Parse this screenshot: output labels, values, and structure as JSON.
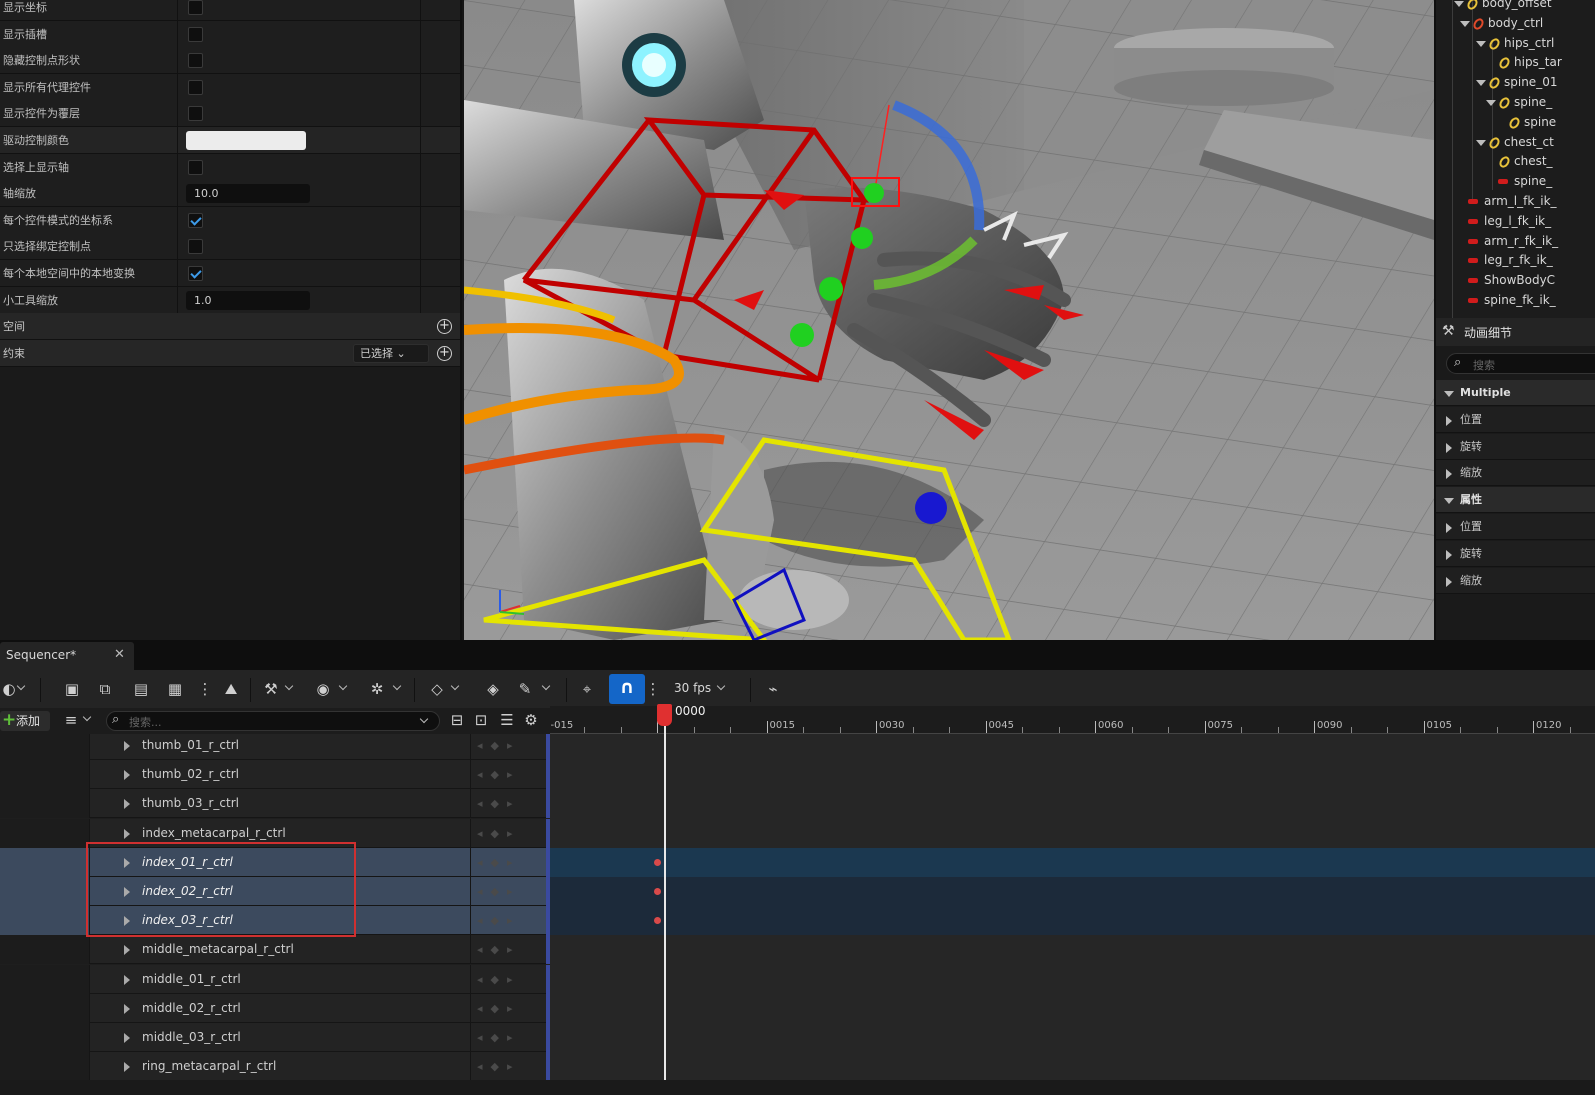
{
  "details": {
    "rows": [
      {
        "label": "显示坐标",
        "type": "checkbox",
        "checked": false
      },
      {
        "label": "显示插槽",
        "type": "checkbox",
        "checked": false
      },
      {
        "label": "隐藏控制点形状",
        "type": "checkbox",
        "checked": false
      },
      {
        "label": "显示所有代理控件",
        "type": "checkbox",
        "checked": false
      },
      {
        "label": "显示控件为覆层",
        "type": "checkbox",
        "checked": false
      },
      {
        "label": "驱动控制颜色",
        "type": "color",
        "value": "#ececec"
      },
      {
        "label": "选择上显示轴",
        "type": "checkbox",
        "checked": false
      },
      {
        "label": "轴缩放",
        "type": "number",
        "value": "10.0"
      },
      {
        "label": "每个控件模式的坐标系",
        "type": "checkbox",
        "checked": true
      },
      {
        "label": "只选择绑定控制点",
        "type": "checkbox",
        "checked": false
      },
      {
        "label": "每个本地空间中的本地变换",
        "type": "checkbox",
        "checked": true
      },
      {
        "label": "小工具缩放",
        "type": "number",
        "value": "1.0"
      }
    ],
    "space_label": "空间",
    "constraint_label": "约束",
    "constraint_dropdown": "已选择"
  },
  "outliner": {
    "items": [
      {
        "label": "body_offset",
        "icon": "ring-yellow"
      },
      {
        "label": "body_ctrl",
        "icon": "ring-red"
      },
      {
        "label": "hips_ctrl",
        "icon": "ring-yellow"
      },
      {
        "label": "hips_tar",
        "icon": "ring-yellow"
      },
      {
        "label": "spine_01",
        "icon": "ring-yellow"
      },
      {
        "label": "spine_",
        "icon": "ring-yellow"
      },
      {
        "label": "spine",
        "icon": "ring-yellow"
      },
      {
        "label": "chest_ct",
        "icon": "ring-yellow"
      },
      {
        "label": "chest_",
        "icon": "ring-yellow"
      },
      {
        "label": "spine_",
        "icon": "bar-red"
      },
      {
        "label": "arm_l_fk_ik_",
        "icon": "bar-red"
      },
      {
        "label": "leg_l_fk_ik_",
        "icon": "bar-red"
      },
      {
        "label": "arm_r_fk_ik_",
        "icon": "bar-red"
      },
      {
        "label": "leg_r_fk_ik_",
        "icon": "bar-red"
      },
      {
        "label": "ShowBodyC",
        "icon": "bar-red"
      },
      {
        "label": "spine_fk_ik_",
        "icon": "bar-red"
      }
    ]
  },
  "anim_details": {
    "title": "动画细节",
    "search_placeholder": "搜索",
    "rows": [
      {
        "label": "Multiple",
        "kind": "category"
      },
      {
        "label": "位置",
        "kind": "item"
      },
      {
        "label": "旋转",
        "kind": "item"
      },
      {
        "label": "缩放",
        "kind": "item"
      },
      {
        "label": "属性",
        "kind": "category"
      },
      {
        "label": "位置",
        "kind": "item"
      },
      {
        "label": "旋转",
        "kind": "item"
      },
      {
        "label": "缩放",
        "kind": "item"
      }
    ]
  },
  "sequencer": {
    "tab_title": "Sequencer*",
    "fps": "30 fps",
    "add_label": "添加",
    "search_placeholder": "搜索...",
    "current_frame": "0000",
    "ruler_labels": [
      "-015",
      "0015",
      "0030",
      "0045",
      "0060",
      "0075",
      "0090",
      "0105",
      "0120"
    ],
    "tracks": [
      {
        "name": "thumb_01_r_ctrl",
        "selected": false
      },
      {
        "name": "thumb_02_r_ctrl",
        "selected": false
      },
      {
        "name": "thumb_03_r_ctrl",
        "selected": false
      },
      {
        "name": "index_metacarpal_r_ctrl",
        "selected": false
      },
      {
        "name": "index_01_r_ctrl",
        "selected": true
      },
      {
        "name": "index_02_r_ctrl",
        "selected": true
      },
      {
        "name": "index_03_r_ctrl",
        "selected": true
      },
      {
        "name": "middle_metacarpal_r_ctrl",
        "selected": false
      },
      {
        "name": "middle_01_r_ctrl",
        "selected": false
      },
      {
        "name": "middle_02_r_ctrl",
        "selected": false
      },
      {
        "name": "middle_03_r_ctrl",
        "selected": false
      },
      {
        "name": "ring_metacarpal_r_ctrl",
        "selected": false
      }
    ]
  },
  "colors": {
    "accent": "#1466c8",
    "playhead": "#e03030",
    "selection_row": "#3c4a5e",
    "selection_box": "#d03030"
  }
}
